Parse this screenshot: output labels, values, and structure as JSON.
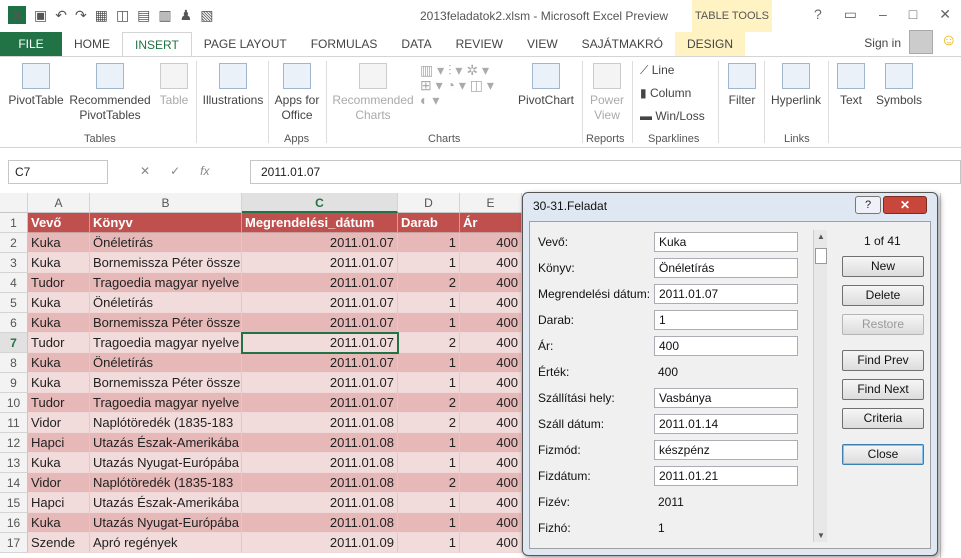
{
  "window": {
    "title": "2013feladatok2.xlsm - Microsoft Excel Preview",
    "table_tools": "TABLE TOOLS",
    "controls": [
      "?",
      "▭",
      "–",
      "□",
      "✕"
    ]
  },
  "tabs": [
    "FILE",
    "HOME",
    "INSERT",
    "PAGE LAYOUT",
    "FORMULAS",
    "DATA",
    "REVIEW",
    "VIEW",
    "SAJÁTMAKRÓ",
    "DESIGN"
  ],
  "active_tab": "INSERT",
  "signin": "Sign in",
  "ribbon": {
    "pivottable": "PivotTable",
    "recommended_pivot": "Recommended PivotTables",
    "table": "Table",
    "group_tables": "Tables",
    "illustrations": "Illustrations",
    "apps_office": "Apps for Office",
    "group_apps": "Apps",
    "recommended_charts": "Recommended Charts",
    "pivotchart": "PivotChart",
    "group_charts": "Charts",
    "power_view": "Power View",
    "group_reports": "Reports",
    "line": "Line",
    "column": "Column",
    "winloss": "Win/Loss",
    "group_sparklines": "Sparklines",
    "filter": "Filter",
    "hyperlink": "Hyperlink",
    "group_links": "Links",
    "text": "Text",
    "symbols": "Symbols"
  },
  "formula_bar": {
    "name_box": "C7",
    "fx": "fx",
    "value": "2011.01.07"
  },
  "columns": [
    "A",
    "B",
    "C",
    "D",
    "E"
  ],
  "header_row": [
    "Vevő",
    "Könyv",
    "Megrendelési_dátum",
    "Darab",
    "Ár"
  ],
  "rows": [
    [
      "2",
      "Kuka",
      "Önéletírás",
      "2011.01.07",
      "1",
      "400"
    ],
    [
      "3",
      "Kuka",
      "Bornemissza Péter össze",
      "2011.01.07",
      "1",
      "400"
    ],
    [
      "4",
      "Tudor",
      "Tragoedia magyar nyelve",
      "2011.01.07",
      "2",
      "400"
    ],
    [
      "5",
      "Kuka",
      "Önéletírás",
      "2011.01.07",
      "1",
      "400"
    ],
    [
      "6",
      "Kuka",
      "Bornemissza Péter össze",
      "2011.01.07",
      "1",
      "400"
    ],
    [
      "7",
      "Tudor",
      "Tragoedia magyar nyelve",
      "2011.01.07",
      "2",
      "400"
    ],
    [
      "8",
      "Kuka",
      "Önéletírás",
      "2011.01.07",
      "1",
      "400"
    ],
    [
      "9",
      "Kuka",
      "Bornemissza Péter össze",
      "2011.01.07",
      "1",
      "400"
    ],
    [
      "10",
      "Tudor",
      "Tragoedia magyar nyelve",
      "2011.01.07",
      "2",
      "400"
    ],
    [
      "11",
      "Vidor",
      "Naplótöredék (1835-183",
      "2011.01.08",
      "2",
      "400"
    ],
    [
      "12",
      "Hapci",
      "Utazás Észak-Amerikába",
      "2011.01.08",
      "1",
      "400"
    ],
    [
      "13",
      "Kuka",
      "Utazás Nyugat-Európába",
      "2011.01.08",
      "1",
      "400"
    ],
    [
      "14",
      "Vidor",
      "Naplótöredék (1835-183",
      "2011.01.08",
      "2",
      "400"
    ],
    [
      "15",
      "Hapci",
      "Utazás Észak-Amerikába",
      "2011.01.08",
      "1",
      "400"
    ],
    [
      "16",
      "Kuka",
      "Utazás Nyugat-Európába",
      "2011.01.08",
      "1",
      "400"
    ],
    [
      "17",
      "Szende",
      "Apró regények",
      "2011.01.09",
      "1",
      "400"
    ]
  ],
  "dialog": {
    "title": "30-31.Feladat",
    "help": "?",
    "close": "✕",
    "record": "1 of 41",
    "fields": [
      {
        "label": "Vevő:",
        "value": "Kuka"
      },
      {
        "label": "Könyv:",
        "value": "Önéletírás"
      },
      {
        "label": "Megrendelési dátum:",
        "value": "2011.01.07"
      },
      {
        "label": "Darab:",
        "value": "1"
      },
      {
        "label": "Ár:",
        "value": "400"
      },
      {
        "label": "Érték:",
        "value": "400"
      },
      {
        "label": "Szállítási hely:",
        "value": "Vasbánya"
      },
      {
        "label": "Száll dátum:",
        "value": "2011.01.14"
      },
      {
        "label": "Fizmód:",
        "value": "készpénz"
      },
      {
        "label": "Fizdátum:",
        "value": "2011.01.21"
      },
      {
        "label": "Fizév:",
        "value": "2011"
      },
      {
        "label": "Fizhó:",
        "value": "1"
      }
    ],
    "buttons": {
      "new": "New",
      "delete": "Delete",
      "restore": "Restore",
      "find_prev": "Find Prev",
      "find_next": "Find Next",
      "criteria": "Criteria",
      "close": "Close"
    }
  }
}
